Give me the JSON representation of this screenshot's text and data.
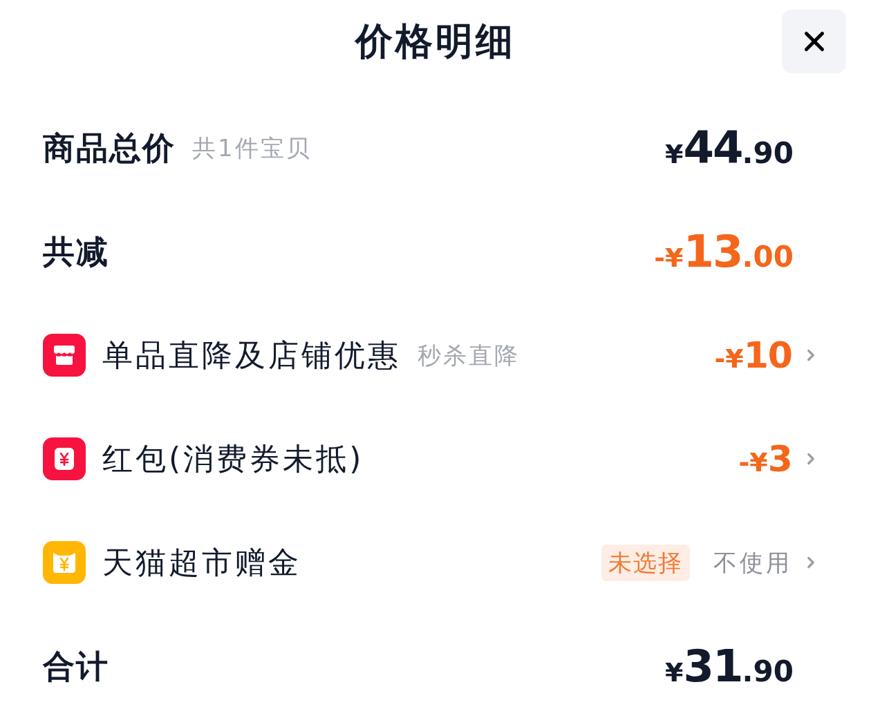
{
  "header": {
    "title": "价格明细"
  },
  "rows": [
    {
      "kind": "summary",
      "label": "商品总价",
      "note": "共1件宝贝",
      "amount": {
        "prefix": "¥",
        "main": "44",
        "fraction": ".90",
        "highlighted": false
      }
    },
    {
      "kind": "summary",
      "label": "共减",
      "amount": {
        "prefix": "-¥",
        "main": "13",
        "fraction": ".00",
        "highlighted": true
      }
    },
    {
      "kind": "store_discount",
      "label": "单品直降及店铺优惠",
      "note": "秒杀直降",
      "amount": {
        "prefix": "-¥",
        "main": "10",
        "highlighted": true
      }
    },
    {
      "kind": "red_packet",
      "label": "红包(消费券未抵)",
      "amount": {
        "prefix": "-¥",
        "main": "3",
        "highlighted": true
      }
    },
    {
      "kind": "supermarket_credit",
      "label": "天猫超市赠金",
      "tag": "未选择",
      "value": "不使用"
    },
    {
      "kind": "summary",
      "label": "合计",
      "amount": {
        "prefix": "¥",
        "main": "31",
        "fraction": ".90",
        "highlighted": false
      }
    }
  ]
}
